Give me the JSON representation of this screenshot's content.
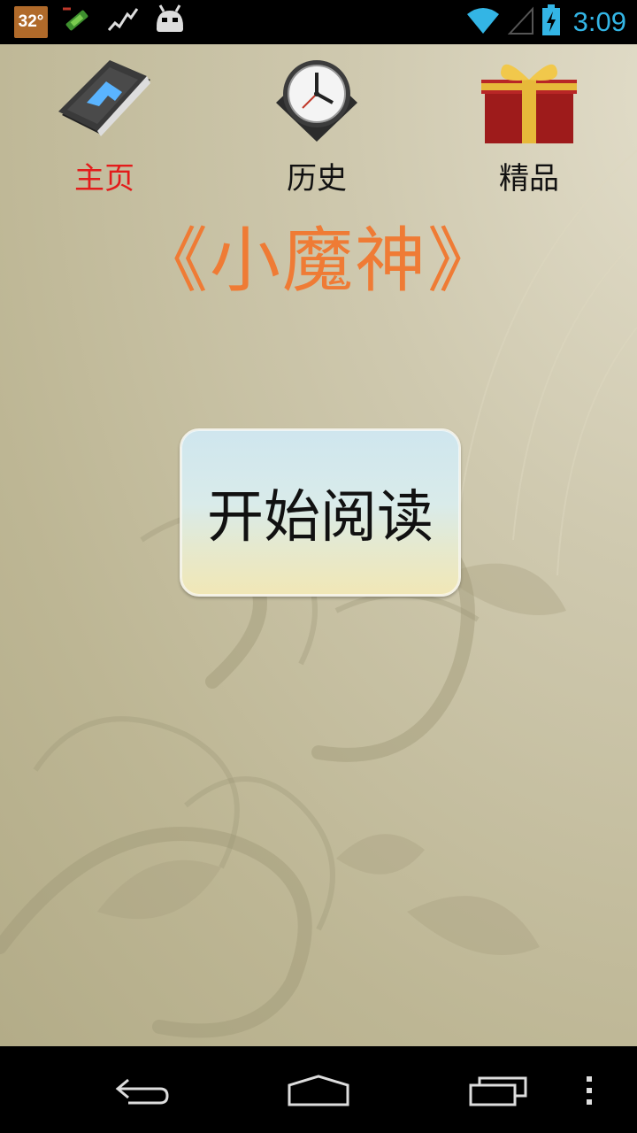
{
  "status_bar": {
    "temperature": "32°",
    "time": "3:09",
    "icons": [
      "temperature-badge",
      "fake-gps-icon",
      "activity-graph-icon",
      "android-mascot-icon",
      "wifi-icon",
      "cell-signal-icon",
      "battery-charging-icon"
    ],
    "accent_color": "#33b5e5"
  },
  "tabs": [
    {
      "label": "主页",
      "icon": "home-book-icon",
      "active": true
    },
    {
      "label": "历史",
      "icon": "clock-icon",
      "active": false
    },
    {
      "label": "精品",
      "icon": "gift-box-icon",
      "active": false
    }
  ],
  "title": "《小魔神》",
  "start_button": {
    "label": "开始阅读"
  },
  "colors": {
    "title": "#ef7b35",
    "active_tab": "#e31b1b"
  },
  "navbar": {
    "icons": [
      "back-icon",
      "home-icon",
      "recent-apps-icon",
      "overflow-menu-icon"
    ]
  }
}
